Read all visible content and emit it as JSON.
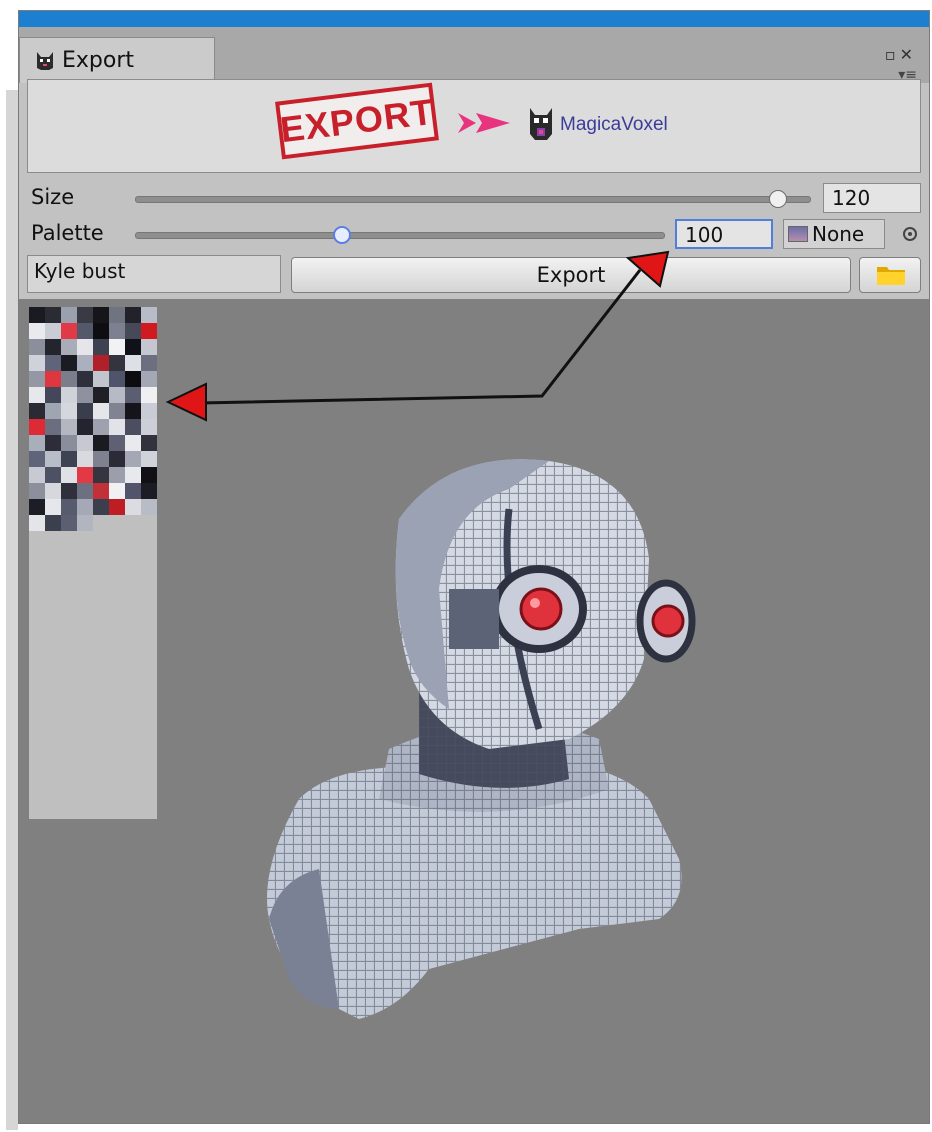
{
  "window": {
    "tab_title": "Export",
    "tab_icon": "voxel-cat-icon",
    "controls": {
      "maximize_icon": "maximize-icon",
      "close_icon": "close-icon",
      "menu_icon": "context-menu-icon"
    }
  },
  "banner": {
    "stamp_text": "EXPORT",
    "arrow_icon": "double-arrow-icon",
    "logo_icon": "magicavoxel-logo-icon",
    "target_label": "MagicaVoxel"
  },
  "size_row": {
    "label": "Size",
    "value": "120",
    "slider_fraction": 0.94
  },
  "palette_row": {
    "label": "Palette",
    "value": "100",
    "slider_fraction": 0.39,
    "object_value": "None",
    "picker_icon": "object-picker-icon"
  },
  "action_row": {
    "name_value": "Kyle bust",
    "export_label": "Export",
    "folder_icon": "folder-icon"
  },
  "palette_preview": {
    "colors": [
      "#1a1a22",
      "#2b2b34",
      "#9aa0ad",
      "#3a3a44",
      "#15151a",
      "#6f7480",
      "#22222a",
      "#b7bcc8",
      "#e9e9ee",
      "#c9cdd6",
      "#e03a46",
      "#53586a",
      "#0e0e12",
      "#7c8090",
      "#454958",
      "#d11a20",
      "#8b8f9b",
      "#24242c",
      "#a8adb8",
      "#e6e6ea",
      "#3e4150",
      "#f2f2f4",
      "#11111a",
      "#c4c7cf",
      "#cfd2da",
      "#60647a",
      "#1b1b22",
      "#aab0bd",
      "#b02028",
      "#34343f",
      "#dde0e6",
      "#6b6f80",
      "#9398a4",
      "#e0363f",
      "#7a7e8c",
      "#2e2f3a",
      "#c1c5cd",
      "#50546a",
      "#0d0d11",
      "#a3a8b4",
      "#e7e8ec",
      "#44475a",
      "#cfd2d9",
      "#8e92a0",
      "#1f1f28",
      "#b6bac4",
      "#5a5e70",
      "#f0f0f2",
      "#292a34",
      "#a0a5b2",
      "#d4d7de",
      "#3a3d4c",
      "#e5e6ea",
      "#7f8392",
      "#14141a",
      "#c9ccd4",
      "#dd2a35",
      "#6a6e7e",
      "#b3b7c2",
      "#23242e",
      "#9ea2ae",
      "#e2e3e8",
      "#4b4e5e",
      "#cccfd7",
      "#a9aebb",
      "#2c2d38",
      "#8a8e9b",
      "#c6c9d1",
      "#1a1a21",
      "#5d6173",
      "#e9eaee",
      "#31323d",
      "#60647a",
      "#b9bdc7",
      "#3f4252",
      "#d8dae0",
      "#7d8190",
      "#2a2b36",
      "#a4a8b4",
      "#d0d3da",
      "#c7cad2",
      "#4e5163",
      "#e0e1e6",
      "#e23a45",
      "#34353f",
      "#9b9fab",
      "#e8e9ed",
      "#101015",
      "#8c909c",
      "#d6d8de",
      "#2f303b",
      "#6c7080",
      "#c23038",
      "#f1f1f3",
      "#51546a",
      "#1c1c24",
      "#1d1d25",
      "#e6e7eb",
      "#575b6d",
      "#a5a9b5",
      "#3b3e4d",
      "#bd1d23",
      "#dadce2",
      "#b8bcc6",
      "#e4e5e9",
      "#3c3f4e",
      "#5b5f71",
      "#b1b5c0"
    ]
  },
  "viewport": {
    "subject_icon": "voxel-robot-bust-icon"
  },
  "colors": {
    "accent_blue": "#1c7fd0",
    "annotation_red": "#e01616",
    "panel_gray": "#c2c2c2",
    "viewport_gray": "#808080"
  }
}
